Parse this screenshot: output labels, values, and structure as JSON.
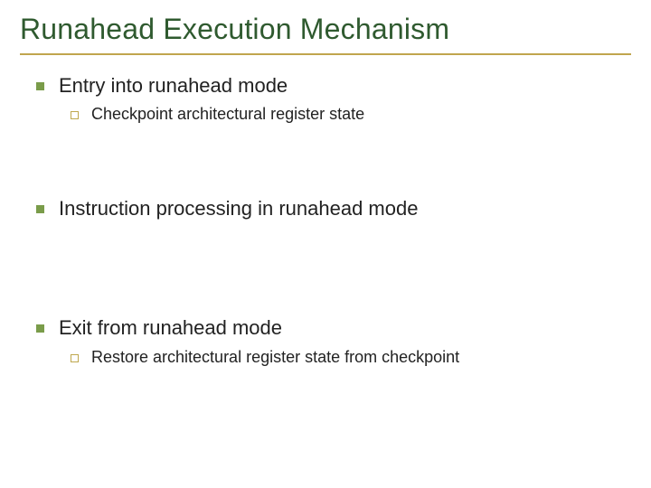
{
  "slide": {
    "title": "Runahead Execution Mechanism",
    "items": [
      {
        "level": 1,
        "text": "Entry into runahead mode"
      },
      {
        "level": 2,
        "text": "Checkpoint architectural register state"
      },
      {
        "level": 1,
        "text": "Instruction processing in runahead mode"
      },
      {
        "level": 1,
        "text": "Exit from runahead mode"
      },
      {
        "level": 2,
        "text": "Restore architectural register state from checkpoint"
      }
    ]
  }
}
